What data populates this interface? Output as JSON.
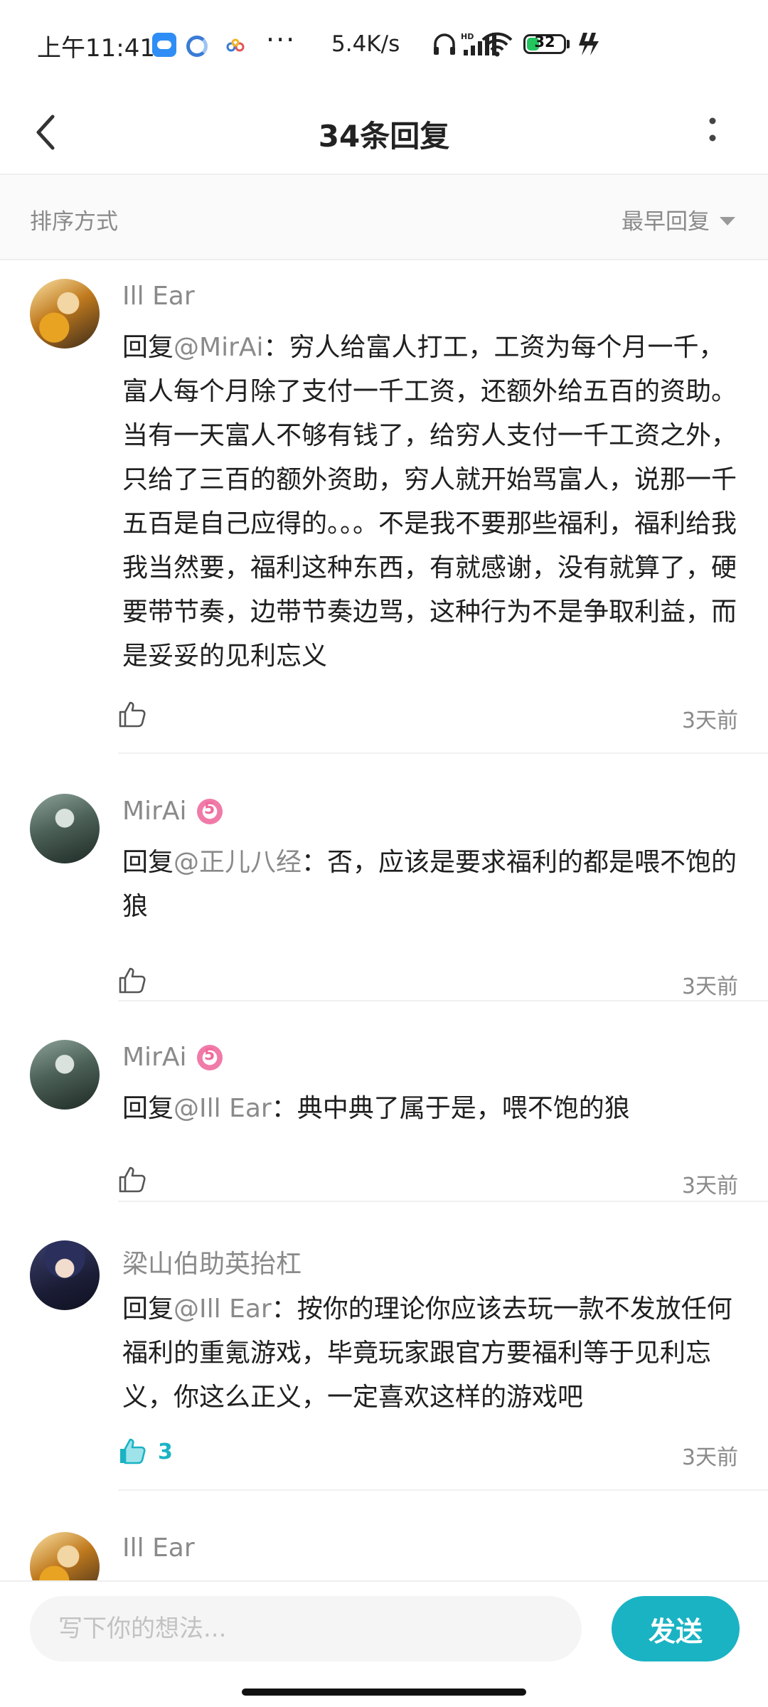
{
  "status_bar": {
    "time": "上午11:41",
    "dots": "···",
    "net_speed": "5.4K/s",
    "battery_level": "32",
    "icons": [
      "cloud-app-icon",
      "ring-app-icon",
      "ribbon-app-icon",
      "headphone-icon",
      "hd-signal-icon",
      "wifi-icon",
      "battery-icon",
      "charging-icon"
    ]
  },
  "header": {
    "title": "34条回复",
    "back_icon": "chevron-left-icon",
    "more_icon": "more-vertical-icon"
  },
  "sort": {
    "label": "排序方式",
    "selected": "最早回复"
  },
  "comments": [
    {
      "username": "Ill Ear",
      "reply_prefix": "回复",
      "mention": "@MirAi",
      "text": "：穷人给富人打工，工资为每个月一千，富人每个月除了支付一千工资，还额外给五百的资助。当有一天富人不够有钱了，给穷人支付一千工资之外，只给了三百的额外资助，穷人就开始骂富人，说那一千五百是自己应得的。。。不是我不要那些福利，福利给我我当然要，福利这种东西，有就感谢，没有就算了，硬要带节奏，边带节奏边骂，这种行为不是争取利益，而是妥妥的见利忘义",
      "time": "3天前"
    },
    {
      "username": "MirAi",
      "badge": "5",
      "reply_prefix": "回复",
      "mention": "@正儿八经",
      "text": "：否，应该是要求福利的都是喂不饱的狼",
      "time": "3天前"
    },
    {
      "username": "MirAi",
      "badge": "5",
      "reply_prefix": "回复",
      "mention": "@Ill Ear",
      "text": "：典中典了属于是，喂不饱的狼",
      "time": "3天前"
    },
    {
      "username": "梁山伯助英抬杠",
      "reply_prefix": "回复",
      "mention": "@Ill Ear",
      "text": "：按你的理论你应该去玩一款不发放任何福利的重氪游戏，毕竟玩家跟官方要福利等于见利忘义，你这么正义，一定喜欢这样的游戏吧",
      "likes": "3",
      "time": "3天前"
    },
    {
      "username": "Ill Ear"
    }
  ],
  "input_bar": {
    "placeholder": "写下你的想法...",
    "send_label": "发送"
  },
  "colors": {
    "accent": "#1ab3c4",
    "muted_text": "#8a8a8a",
    "badge_pink": "#f07aa8"
  }
}
